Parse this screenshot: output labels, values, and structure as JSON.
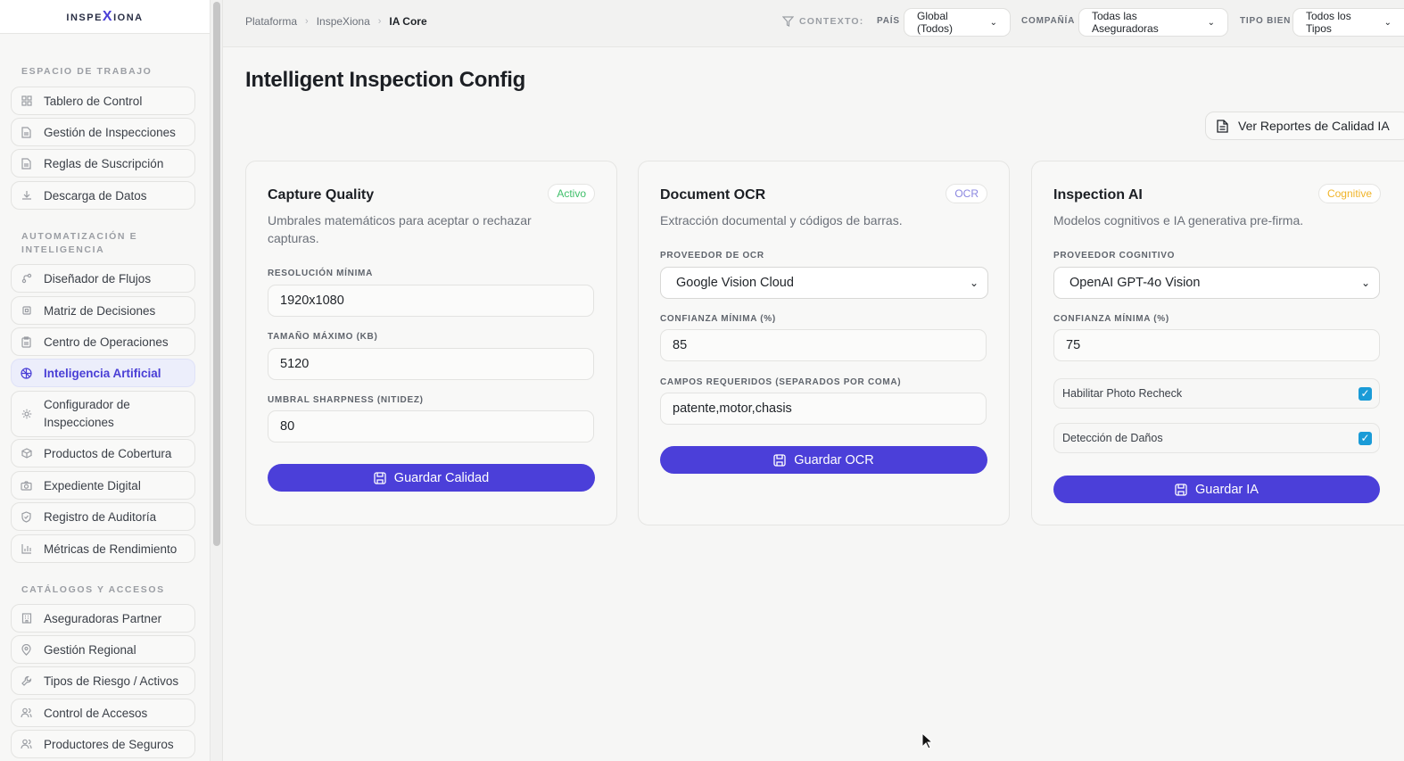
{
  "app": {
    "logo_text": "INSPE",
    "logo_x": "X",
    "logo_rest": "IONA"
  },
  "sidebar": {
    "sections": [
      {
        "title": "ESPACIO DE TRABAJO"
      },
      {
        "title": "AUTOMATIZACIÓN E INTELIGENCIA"
      },
      {
        "title": "CATÁLOGOS Y ACCESOS"
      }
    ],
    "items": [
      {
        "label": "Tablero de Control",
        "icon": "grid-icon"
      },
      {
        "label": "Gestión de Inspecciones",
        "icon": "document-icon"
      },
      {
        "label": "Reglas de Suscripción",
        "icon": "document-icon"
      },
      {
        "label": "Descarga de Datos",
        "icon": "download-icon"
      },
      {
        "label": "Diseñador de Flujos",
        "icon": "workflow-icon"
      },
      {
        "label": "Matriz de Decisiones",
        "icon": "cpu-icon"
      },
      {
        "label": "Centro de Operaciones",
        "icon": "clipboard-icon"
      },
      {
        "label": "Inteligencia Artificial",
        "icon": "brain-icon"
      },
      {
        "label": "Configurador de Inspecciones",
        "icon": "gear-icon"
      },
      {
        "label": "Productos de Cobertura",
        "icon": "box-icon"
      },
      {
        "label": "Expediente Digital",
        "icon": "camera-icon"
      },
      {
        "label": "Registro de Auditoría",
        "icon": "shield-icon"
      },
      {
        "label": "Métricas de Rendimiento",
        "icon": "bar-chart-icon"
      },
      {
        "label": "Aseguradoras Partner",
        "icon": "building-icon"
      },
      {
        "label": "Gestión Regional",
        "icon": "map-pin-icon"
      },
      {
        "label": "Tipos de Riesgo / Activos",
        "icon": "tool-icon"
      },
      {
        "label": "Control de Accesos",
        "icon": "users-icon"
      },
      {
        "label": "Productores de Seguros",
        "icon": "users-icon"
      }
    ]
  },
  "topbar": {
    "breadcrumbs": [
      "Plataforma",
      "InspeXiona",
      "IA Core"
    ],
    "context_label": "CONTEXTO:",
    "filters": [
      {
        "label": "PAÍS",
        "value": "Global (Todos)"
      },
      {
        "label": "COMPAÑÍA",
        "value": "Todas las Aseguradoras"
      },
      {
        "label": "TIPO BIEN",
        "value": "Todos los Tipos"
      }
    ]
  },
  "main": {
    "title": "Intelligent Inspection Config",
    "report_button": "Ver Reportes de Calidad IA",
    "cards": [
      {
        "title": "Capture Quality",
        "badge": "Activo",
        "badge_color": "#3fbf6a",
        "description": "Umbrales matemáticos para aceptar o rechazar capturas.",
        "fields": [
          {
            "label": "RESOLUCIÓN MÍNIMA",
            "value": "1920x1080"
          },
          {
            "label": "TAMAÑO MÁXIMO (KB)",
            "value": "5120"
          },
          {
            "label": "UMBRAL SHARPNESS (NITIDEZ)",
            "value": "80"
          }
        ],
        "button": "Guardar Calidad"
      },
      {
        "title": "Document OCR",
        "badge": "OCR",
        "badge_color": "#8b87e0",
        "description": "Extracción documental y códigos de barras.",
        "select_label": "PROVEEDOR DE OCR",
        "select_value": "Google Vision Cloud",
        "fields": [
          {
            "label": "CONFIANZA MÍNIMA (%)",
            "value": "85"
          },
          {
            "label": "CAMPOS REQUERIDOS (SEPARADOS POR COMA)",
            "value": "patente,motor,chasis"
          }
        ],
        "button": "Guardar OCR"
      },
      {
        "title": "Inspection AI",
        "badge": "Cognitive",
        "badge_color": "#f0b429",
        "description": "Modelos cognitivos e IA generativa pre-firma.",
        "select_label": "PROVEEDOR COGNITIVO",
        "select_value": "OpenAI GPT-4o Vision",
        "fields": [
          {
            "label": "CONFIANZA MÍNIMA (%)",
            "value": "75"
          }
        ],
        "checks": [
          {
            "label": "Habilitar Photo Recheck",
            "checked": true
          },
          {
            "label": "Detección de Daños",
            "checked": true
          }
        ],
        "button": "Guardar IA"
      }
    ]
  },
  "colors": {
    "accent": "#4b3fd9",
    "checkbox": "#1a9bd7"
  }
}
